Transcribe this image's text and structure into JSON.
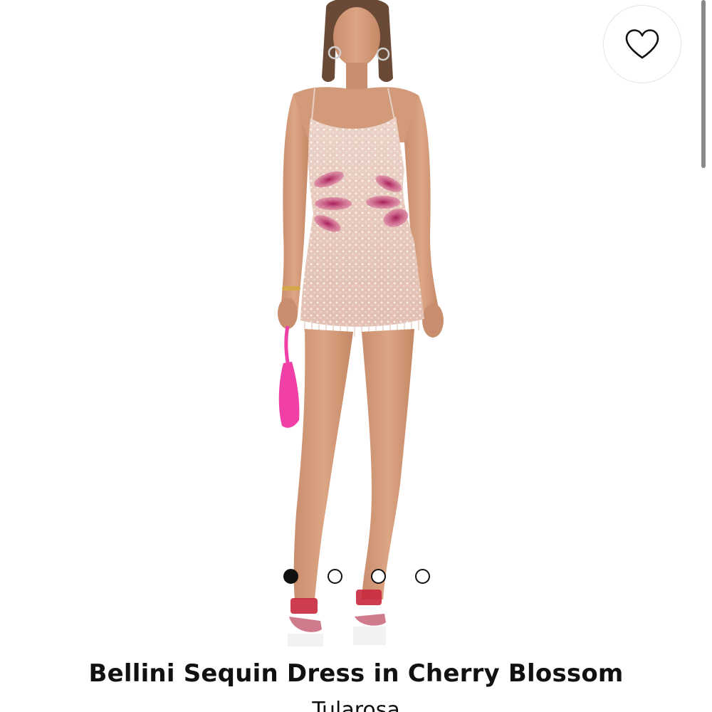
{
  "product": {
    "title": "Bellini Sequin Dress in Cherry Blossom",
    "brand": "Tularosa",
    "image": {
      "subject": "model-wearing-sequin-mini-dress",
      "dress_color": "#eac9c0",
      "accent_color": "#c24078",
      "bag_color": "#f03fa7",
      "shoe_color": "#c8283c"
    }
  },
  "favorite": {
    "icon": "heart-outline-icon"
  },
  "carousel": {
    "total": 4,
    "active_index": 0
  },
  "theme": {
    "text": "#111111",
    "background": "#ffffff",
    "border": "#e4e4e4"
  }
}
